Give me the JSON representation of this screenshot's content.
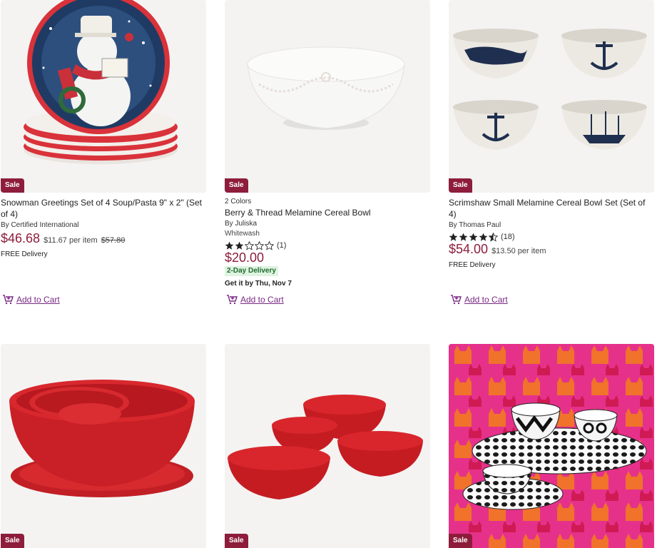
{
  "products": [
    {
      "sale_label": "Sale",
      "title": "Snowman Greetings Set of 4 Soup/Pasta 9\" x 2\" (Set of 4)",
      "by": "By Certified International",
      "price": "$46.68",
      "per_item": "$11.67 per item",
      "was_price": "$57.80",
      "delivery": "FREE Delivery",
      "add_to_cart": "Add to Cart"
    },
    {
      "sale_label": "Sale",
      "colors": "2 Colors",
      "title": "Berry & Thread Melamine Cereal Bowl",
      "by": "By Juliska",
      "variant": "Whitewash",
      "rating": 2,
      "rating_count": "(1)",
      "price": "$20.00",
      "badge": "2-Day Delivery",
      "get_it": "Get it by Thu, Nov 7",
      "add_to_cart": "Add to Cart"
    },
    {
      "sale_label": "Sale",
      "title": "Scrimshaw Small Melamine Cereal Bowl Set (Set of 4)",
      "by": "By Thomas Paul",
      "rating": 4.5,
      "rating_count": "(18)",
      "price": "$54.00",
      "per_item": "$13.50 per item",
      "delivery": "FREE Delivery",
      "add_to_cart": "Add to Cart"
    },
    {
      "sale_label": "Sale"
    },
    {
      "sale_label": "Sale"
    },
    {
      "sale_label": "Sale"
    }
  ],
  "colors": {
    "sale_badge": "#8d1d3b",
    "price": "#8d1d3b",
    "add_to_cart": "#7a2a84",
    "two_day_bg": "#dff3e1",
    "two_day_text": "#1f6b2d"
  },
  "icons": {
    "cart": "add-to-cart-icon",
    "star_full": "star-filled-icon",
    "star_empty": "star-empty-icon",
    "star_half": "star-half-icon"
  }
}
